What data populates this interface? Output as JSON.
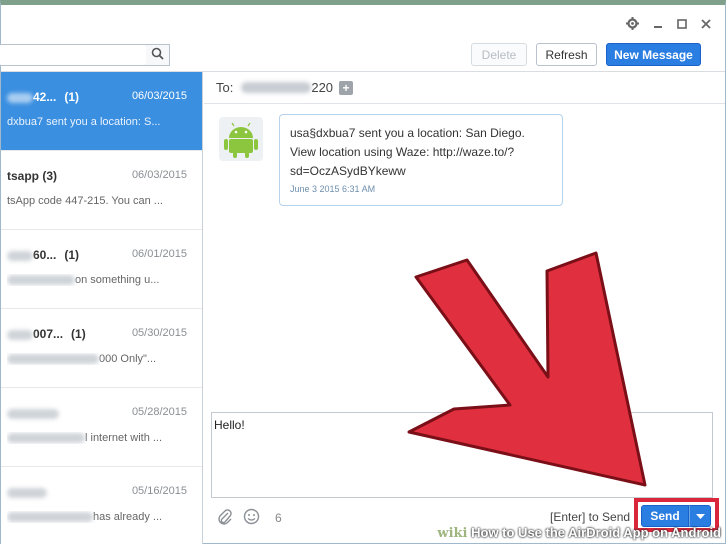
{
  "window": {
    "controls": [
      "gear-icon",
      "minimize-icon",
      "maximize-icon",
      "close-icon"
    ]
  },
  "toolbar": {
    "search_value": "",
    "delete_label": "Delete",
    "refresh_label": "Refresh",
    "new_message_label": "New Message"
  },
  "conversations": [
    {
      "name_tail": "42...",
      "count": "(1)",
      "date": "06/03/2015",
      "preview": "dxbua7 sent you a location: S...",
      "selected": true
    },
    {
      "name_tail": "tsapp (3)",
      "count": "",
      "date": "06/03/2015",
      "preview": "tsApp code 447-215. You can ...",
      "selected": false
    },
    {
      "name_tail": "60...",
      "count": "(1)",
      "date": "06/01/2015",
      "preview": "on something u...",
      "selected": false
    },
    {
      "name_tail": "007...",
      "count": "(1)",
      "date": "05/30/2015",
      "preview": "000 Only\"...",
      "selected": false
    },
    {
      "name_tail": "",
      "count": "",
      "date": "05/28/2015",
      "preview": "l internet with ...",
      "selected": false
    },
    {
      "name_tail": "",
      "count": "",
      "date": "05/16/2015",
      "preview": "has already ...",
      "selected": false
    }
  ],
  "chat": {
    "to_label": "To:",
    "to_number_tail": "220",
    "message_text": "usa§dxbua7 sent you a location: San Diego. View location using Waze: http://waze.to/?sd=OczASydBYkeww",
    "message_time": "June 3 2015 6:31 AM"
  },
  "compose": {
    "value": "Hello!",
    "char_count": "6",
    "enter_hint": "[Enter] to Send",
    "send_label": "Send"
  },
  "colors": {
    "accent": "#2a7de1",
    "selected_row": "#3b8fe0",
    "highlight": "#d9263b",
    "android_green": "#8cc63f"
  },
  "watermark": {
    "wiki": "wiki",
    "title": "How to Use the AirDroid App on Android"
  }
}
